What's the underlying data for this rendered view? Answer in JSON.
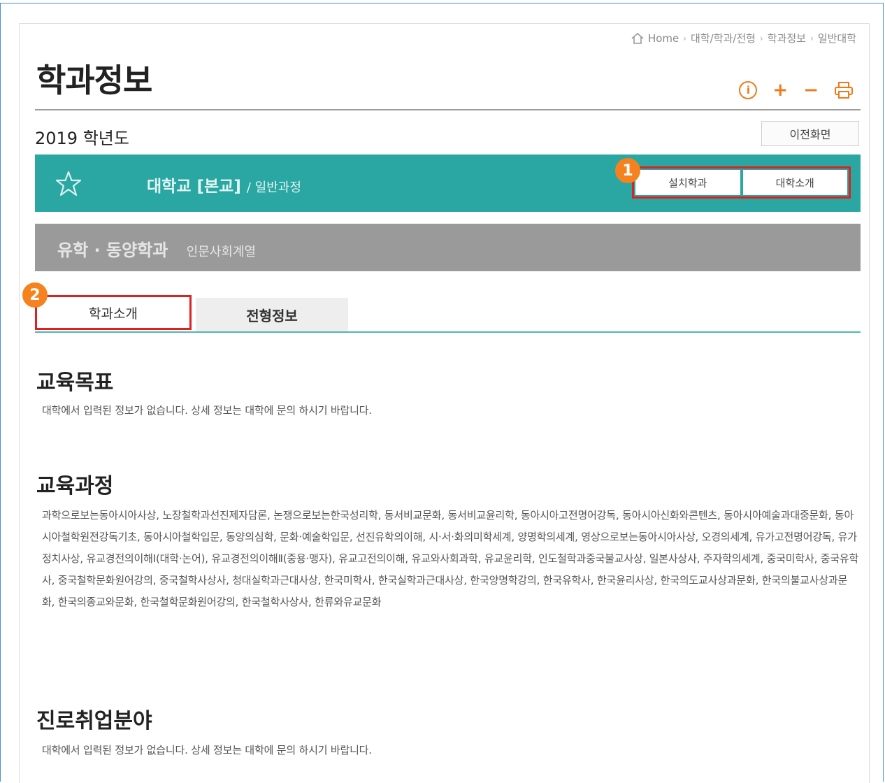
{
  "breadcrumb": {
    "home": "Home",
    "items": [
      "대학/학과/전형",
      "학과정보",
      "일반대학"
    ]
  },
  "page_title": "학과정보",
  "tools": {
    "info": "i",
    "zoom_in": "+",
    "zoom_out": "−"
  },
  "year_label": "2019 학년도",
  "prev_button": "이전화면",
  "university": {
    "name": "대학교 [본교]",
    "course": "/ 일반과정"
  },
  "actions": {
    "departments": "설치학과",
    "intro": "대학소개"
  },
  "badges": {
    "first": "1",
    "second": "2"
  },
  "major": {
    "name": "유학 · 동양학과",
    "field": "인문사회계열"
  },
  "tabs": {
    "active": "학과소개",
    "other": "전형정보"
  },
  "sections": [
    {
      "title": "교육목표",
      "text": "대학에서 입력된 정보가 없습니다. 상세 정보는 대학에 문의 하시기 바랍니다."
    },
    {
      "title": "교육과정",
      "text": "과학으로보는동아시아사상, 노장철학과선진제자담론, 논쟁으로보는한국성리학, 동서비교문화, 동서비교윤리학, 동아시아고전명어강독, 동아시아신화와콘텐츠, 동아시아예술과대중문화, 동아시아철학원전강독기초, 동아시아철학입문, 동양의심학, 문화·예술학입문, 선진유학의이해, 시·서·화의미학세계, 양명학의세계, 영상으로보는동아시아사상, 오경의세계, 유가고전명어강독, 유가정치사상, 유교경전의이해Ⅰ(대학·논어), 유교경전의이해Ⅱ(중용·맹자), 유교고전의이해, 유교와사회과학, 유교윤리학, 인도철학과중국불교사상, 일본사상사, 주자학의세계, 중국미학사, 중국유학사, 중국철학문화원어강의, 중국철학사상사, 청대실학과근대사상, 한국미학사, 한국실학과근대사상, 한국양명학강의, 한국유학사, 한국윤리사상, 한국의도교사상과문화, 한국의불교사상과문화, 한국의종교와문화, 한국철학문화원어강의, 한국철학사상사, 한류와유교문화"
    },
    {
      "title": "진로취업분야",
      "text": "대학에서 입력된 정보가 없습니다. 상세 정보는 대학에 문의 하시기 바랍니다."
    }
  ],
  "colors": {
    "teal": "#2aa7a2",
    "gray": "#9a9a9a",
    "accent": "#f07a1a",
    "highlight": "#e02020"
  },
  "icons": [
    "home-icon",
    "info-icon",
    "zoom-in-icon",
    "zoom-out-icon",
    "print-icon",
    "star-icon"
  ]
}
